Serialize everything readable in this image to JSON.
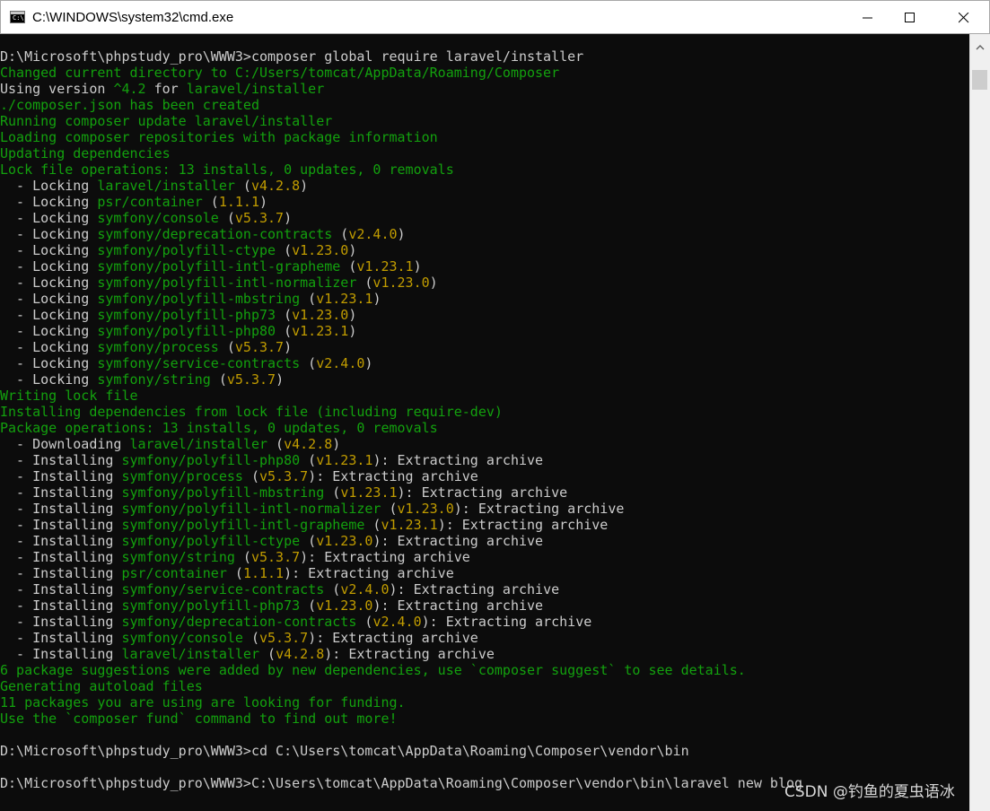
{
  "window": {
    "title": "C:\\WINDOWS\\system32\\cmd.exe",
    "icon_label": "C:\\",
    "controls": {
      "minimize_icon": "minimize-icon",
      "maximize_icon": "maximize-icon",
      "close_icon": "close-icon"
    }
  },
  "colors": {
    "background": "#0c0c0c",
    "text_default": "#cccccc",
    "text_green": "#13a10e",
    "text_yellow": "#c19c00"
  },
  "console": {
    "lines": [
      [
        {
          "t": "D:\\Microsoft\\phpstudy_pro\\WWW3>composer global require laravel/installer",
          "c": "w"
        }
      ],
      [
        {
          "t": "Changed current directory to C:/Users/tomcat/AppData/Roaming/Composer",
          "c": "g"
        }
      ],
      [
        {
          "t": "Using version ",
          "c": "w"
        },
        {
          "t": "^4.2",
          "c": "g"
        },
        {
          "t": " for ",
          "c": "w"
        },
        {
          "t": "laravel/installer",
          "c": "g"
        }
      ],
      [
        {
          "t": "./composer.json has been created",
          "c": "g"
        }
      ],
      [
        {
          "t": "Running composer update laravel/installer",
          "c": "g"
        }
      ],
      [
        {
          "t": "Loading composer repositories with package information",
          "c": "g"
        }
      ],
      [
        {
          "t": "Updating dependencies",
          "c": "g"
        }
      ],
      [
        {
          "t": "Lock file operations: 13 installs, 0 updates, 0 removals",
          "c": "g"
        }
      ],
      [
        {
          "t": "  - Locking ",
          "c": "w"
        },
        {
          "t": "laravel/installer",
          "c": "g"
        },
        {
          "t": " (",
          "c": "w"
        },
        {
          "t": "v4.2.8",
          "c": "y"
        },
        {
          "t": ")",
          "c": "w"
        }
      ],
      [
        {
          "t": "  - Locking ",
          "c": "w"
        },
        {
          "t": "psr/container",
          "c": "g"
        },
        {
          "t": " (",
          "c": "w"
        },
        {
          "t": "1.1.1",
          "c": "y"
        },
        {
          "t": ")",
          "c": "w"
        }
      ],
      [
        {
          "t": "  - Locking ",
          "c": "w"
        },
        {
          "t": "symfony/console",
          "c": "g"
        },
        {
          "t": " (",
          "c": "w"
        },
        {
          "t": "v5.3.7",
          "c": "y"
        },
        {
          "t": ")",
          "c": "w"
        }
      ],
      [
        {
          "t": "  - Locking ",
          "c": "w"
        },
        {
          "t": "symfony/deprecation-contracts",
          "c": "g"
        },
        {
          "t": " (",
          "c": "w"
        },
        {
          "t": "v2.4.0",
          "c": "y"
        },
        {
          "t": ")",
          "c": "w"
        }
      ],
      [
        {
          "t": "  - Locking ",
          "c": "w"
        },
        {
          "t": "symfony/polyfill-ctype",
          "c": "g"
        },
        {
          "t": " (",
          "c": "w"
        },
        {
          "t": "v1.23.0",
          "c": "y"
        },
        {
          "t": ")",
          "c": "w"
        }
      ],
      [
        {
          "t": "  - Locking ",
          "c": "w"
        },
        {
          "t": "symfony/polyfill-intl-grapheme",
          "c": "g"
        },
        {
          "t": " (",
          "c": "w"
        },
        {
          "t": "v1.23.1",
          "c": "y"
        },
        {
          "t": ")",
          "c": "w"
        }
      ],
      [
        {
          "t": "  - Locking ",
          "c": "w"
        },
        {
          "t": "symfony/polyfill-intl-normalizer",
          "c": "g"
        },
        {
          "t": " (",
          "c": "w"
        },
        {
          "t": "v1.23.0",
          "c": "y"
        },
        {
          "t": ")",
          "c": "w"
        }
      ],
      [
        {
          "t": "  - Locking ",
          "c": "w"
        },
        {
          "t": "symfony/polyfill-mbstring",
          "c": "g"
        },
        {
          "t": " (",
          "c": "w"
        },
        {
          "t": "v1.23.1",
          "c": "y"
        },
        {
          "t": ")",
          "c": "w"
        }
      ],
      [
        {
          "t": "  - Locking ",
          "c": "w"
        },
        {
          "t": "symfony/polyfill-php73",
          "c": "g"
        },
        {
          "t": " (",
          "c": "w"
        },
        {
          "t": "v1.23.0",
          "c": "y"
        },
        {
          "t": ")",
          "c": "w"
        }
      ],
      [
        {
          "t": "  - Locking ",
          "c": "w"
        },
        {
          "t": "symfony/polyfill-php80",
          "c": "g"
        },
        {
          "t": " (",
          "c": "w"
        },
        {
          "t": "v1.23.1",
          "c": "y"
        },
        {
          "t": ")",
          "c": "w"
        }
      ],
      [
        {
          "t": "  - Locking ",
          "c": "w"
        },
        {
          "t": "symfony/process",
          "c": "g"
        },
        {
          "t": " (",
          "c": "w"
        },
        {
          "t": "v5.3.7",
          "c": "y"
        },
        {
          "t": ")",
          "c": "w"
        }
      ],
      [
        {
          "t": "  - Locking ",
          "c": "w"
        },
        {
          "t": "symfony/service-contracts",
          "c": "g"
        },
        {
          "t": " (",
          "c": "w"
        },
        {
          "t": "v2.4.0",
          "c": "y"
        },
        {
          "t": ")",
          "c": "w"
        }
      ],
      [
        {
          "t": "  - Locking ",
          "c": "w"
        },
        {
          "t": "symfony/string",
          "c": "g"
        },
        {
          "t": " (",
          "c": "w"
        },
        {
          "t": "v5.3.7",
          "c": "y"
        },
        {
          "t": ")",
          "c": "w"
        }
      ],
      [
        {
          "t": "Writing lock file",
          "c": "g"
        }
      ],
      [
        {
          "t": "Installing dependencies from lock file (including require-dev)",
          "c": "g"
        }
      ],
      [
        {
          "t": "Package operations: 13 installs, 0 updates, 0 removals",
          "c": "g"
        }
      ],
      [
        {
          "t": "  - Downloading ",
          "c": "w"
        },
        {
          "t": "laravel/installer",
          "c": "g"
        },
        {
          "t": " (",
          "c": "w"
        },
        {
          "t": "v4.2.8",
          "c": "y"
        },
        {
          "t": ")",
          "c": "w"
        }
      ],
      [
        {
          "t": "  - Installing ",
          "c": "w"
        },
        {
          "t": "symfony/polyfill-php80",
          "c": "g"
        },
        {
          "t": " (",
          "c": "w"
        },
        {
          "t": "v1.23.1",
          "c": "y"
        },
        {
          "t": "): Extracting archive",
          "c": "w"
        }
      ],
      [
        {
          "t": "  - Installing ",
          "c": "w"
        },
        {
          "t": "symfony/process",
          "c": "g"
        },
        {
          "t": " (",
          "c": "w"
        },
        {
          "t": "v5.3.7",
          "c": "y"
        },
        {
          "t": "): Extracting archive",
          "c": "w"
        }
      ],
      [
        {
          "t": "  - Installing ",
          "c": "w"
        },
        {
          "t": "symfony/polyfill-mbstring",
          "c": "g"
        },
        {
          "t": " (",
          "c": "w"
        },
        {
          "t": "v1.23.1",
          "c": "y"
        },
        {
          "t": "): Extracting archive",
          "c": "w"
        }
      ],
      [
        {
          "t": "  - Installing ",
          "c": "w"
        },
        {
          "t": "symfony/polyfill-intl-normalizer",
          "c": "g"
        },
        {
          "t": " (",
          "c": "w"
        },
        {
          "t": "v1.23.0",
          "c": "y"
        },
        {
          "t": "): Extracting archive",
          "c": "w"
        }
      ],
      [
        {
          "t": "  - Installing ",
          "c": "w"
        },
        {
          "t": "symfony/polyfill-intl-grapheme",
          "c": "g"
        },
        {
          "t": " (",
          "c": "w"
        },
        {
          "t": "v1.23.1",
          "c": "y"
        },
        {
          "t": "): Extracting archive",
          "c": "w"
        }
      ],
      [
        {
          "t": "  - Installing ",
          "c": "w"
        },
        {
          "t": "symfony/polyfill-ctype",
          "c": "g"
        },
        {
          "t": " (",
          "c": "w"
        },
        {
          "t": "v1.23.0",
          "c": "y"
        },
        {
          "t": "): Extracting archive",
          "c": "w"
        }
      ],
      [
        {
          "t": "  - Installing ",
          "c": "w"
        },
        {
          "t": "symfony/string",
          "c": "g"
        },
        {
          "t": " (",
          "c": "w"
        },
        {
          "t": "v5.3.7",
          "c": "y"
        },
        {
          "t": "): Extracting archive",
          "c": "w"
        }
      ],
      [
        {
          "t": "  - Installing ",
          "c": "w"
        },
        {
          "t": "psr/container",
          "c": "g"
        },
        {
          "t": " (",
          "c": "w"
        },
        {
          "t": "1.1.1",
          "c": "y"
        },
        {
          "t": "): Extracting archive",
          "c": "w"
        }
      ],
      [
        {
          "t": "  - Installing ",
          "c": "w"
        },
        {
          "t": "symfony/service-contracts",
          "c": "g"
        },
        {
          "t": " (",
          "c": "w"
        },
        {
          "t": "v2.4.0",
          "c": "y"
        },
        {
          "t": "): Extracting archive",
          "c": "w"
        }
      ],
      [
        {
          "t": "  - Installing ",
          "c": "w"
        },
        {
          "t": "symfony/polyfill-php73",
          "c": "g"
        },
        {
          "t": " (",
          "c": "w"
        },
        {
          "t": "v1.23.0",
          "c": "y"
        },
        {
          "t": "): Extracting archive",
          "c": "w"
        }
      ],
      [
        {
          "t": "  - Installing ",
          "c": "w"
        },
        {
          "t": "symfony/deprecation-contracts",
          "c": "g"
        },
        {
          "t": " (",
          "c": "w"
        },
        {
          "t": "v2.4.0",
          "c": "y"
        },
        {
          "t": "): Extracting archive",
          "c": "w"
        }
      ],
      [
        {
          "t": "  - Installing ",
          "c": "w"
        },
        {
          "t": "symfony/console",
          "c": "g"
        },
        {
          "t": " (",
          "c": "w"
        },
        {
          "t": "v5.3.7",
          "c": "y"
        },
        {
          "t": "): Extracting archive",
          "c": "w"
        }
      ],
      [
        {
          "t": "  - Installing ",
          "c": "w"
        },
        {
          "t": "laravel/installer",
          "c": "g"
        },
        {
          "t": " (",
          "c": "w"
        },
        {
          "t": "v4.2.8",
          "c": "y"
        },
        {
          "t": "): Extracting archive",
          "c": "w"
        }
      ],
      [
        {
          "t": "6 package suggestions were added by new dependencies, use `composer suggest` to see details.",
          "c": "g"
        }
      ],
      [
        {
          "t": "Generating autoload files",
          "c": "g"
        }
      ],
      [
        {
          "t": "11 packages you are using are looking for funding.",
          "c": "g"
        }
      ],
      [
        {
          "t": "Use the `composer fund` command to find out more!",
          "c": "g"
        }
      ],
      [
        {
          "t": "",
          "c": "w"
        }
      ],
      [
        {
          "t": "D:\\Microsoft\\phpstudy_pro\\WWW3>cd C:\\Users\\tomcat\\AppData\\Roaming\\Composer\\vendor\\bin",
          "c": "w"
        }
      ],
      [
        {
          "t": "",
          "c": "w"
        }
      ],
      [
        {
          "t": "D:\\Microsoft\\phpstudy_pro\\WWW3>C:\\Users\\tomcat\\AppData\\Roaming\\Composer\\vendor\\bin\\laravel new blog",
          "c": "w"
        }
      ]
    ]
  },
  "scrollbar": {
    "up_icon": "scroll-up-arrow-icon"
  },
  "watermark": {
    "text": "CSDN @钓鱼的夏虫语冰"
  }
}
